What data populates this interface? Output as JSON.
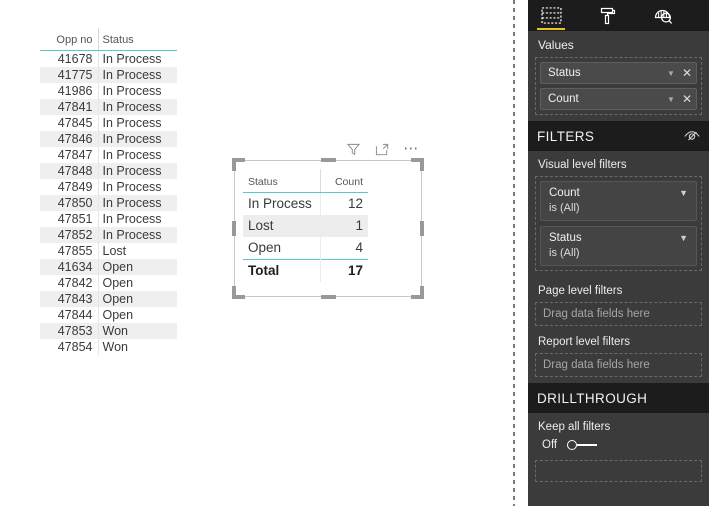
{
  "canvas": {
    "opp_table": {
      "columns": [
        "Opp no",
        "Status"
      ],
      "rows": [
        [
          "41678",
          "In Process"
        ],
        [
          "41775",
          "In Process"
        ],
        [
          "41986",
          "In Process"
        ],
        [
          "47841",
          "In Process"
        ],
        [
          "47845",
          "In Process"
        ],
        [
          "47846",
          "In Process"
        ],
        [
          "47847",
          "In Process"
        ],
        [
          "47848",
          "In Process"
        ],
        [
          "47849",
          "In Process"
        ],
        [
          "47850",
          "In Process"
        ],
        [
          "47851",
          "In Process"
        ],
        [
          "47852",
          "In Process"
        ],
        [
          "47855",
          "Lost"
        ],
        [
          "41634",
          "Open"
        ],
        [
          "47842",
          "Open"
        ],
        [
          "47843",
          "Open"
        ],
        [
          "47844",
          "Open"
        ],
        [
          "47853",
          "Won"
        ],
        [
          "47854",
          "Won"
        ]
      ]
    },
    "visual_icons": [
      {
        "name": "filter-icon",
        "label": "Filters"
      },
      {
        "name": "focus-mode-icon",
        "label": "Focus mode"
      },
      {
        "name": "more-options-icon",
        "label": "More options"
      }
    ],
    "summary_table": {
      "columns": [
        "Status",
        "Count"
      ],
      "rows": [
        [
          "In Process",
          "12"
        ],
        [
          "Lost",
          "1"
        ],
        [
          "Open",
          "4"
        ]
      ],
      "total_label": "Total",
      "total_value": "17"
    }
  },
  "right_pane": {
    "tabs": [
      {
        "name": "fields-tab",
        "icon": "fields-icon",
        "label": "Fields",
        "active": true
      },
      {
        "name": "format-tab",
        "icon": "paint-roller-icon",
        "label": "Format",
        "active": false
      },
      {
        "name": "analytics-tab",
        "icon": "analytics-magnifier-icon",
        "label": "Analytics",
        "active": false
      }
    ],
    "values": {
      "label": "Values",
      "fields": [
        {
          "name": "Status"
        },
        {
          "name": "Count"
        }
      ]
    },
    "filters": {
      "title": "FILTERS",
      "header_icon": "hide-filters-eye-icon",
      "visual_level": {
        "label": "Visual level filters",
        "cards": [
          {
            "name": "Count",
            "condition": "is (All)"
          },
          {
            "name": "Status",
            "condition": "is (All)"
          }
        ]
      },
      "page_level": {
        "label": "Page level filters",
        "dropzone_placeholder": "Drag data fields here"
      },
      "report_level": {
        "label": "Report level filters",
        "dropzone_placeholder": "Drag data fields here"
      }
    },
    "drillthrough": {
      "title": "DRILLTHROUGH",
      "keep_all_filters_label": "Keep all filters",
      "toggle_state": "Off"
    }
  },
  "colors": {
    "accent_teal": "#5bc8c8",
    "tab_active_underline": "#e8c32a",
    "pane_background": "#3b3b3b",
    "pane_header_background": "#1c1c1c"
  }
}
